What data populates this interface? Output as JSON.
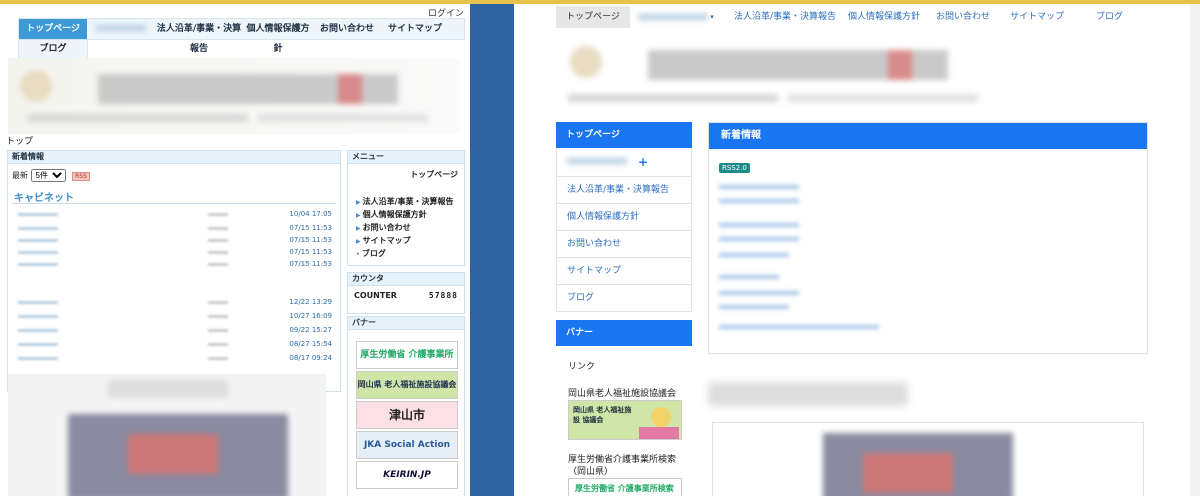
{
  "old_site": {
    "login": "ログイン",
    "nav_row1": [
      "トップページ",
      "",
      "法人沿革/事業・決算報告",
      "個人情報保護方針",
      "お問い合わせ",
      "サイトマップ"
    ],
    "nav_row2": "ブログ",
    "breadcrumb": "トップ",
    "news": {
      "title": "新着情報",
      "filter_label": "最新",
      "filter_value": "5件",
      "rss": "RSS",
      "cabinet": "キャビネット",
      "dates_group1": [
        "10/04 17:05",
        "07/15 11:53",
        "07/15 11:53",
        "07/15 11:53",
        "07/15 11:53"
      ],
      "dates_group2": [
        "12/22 13:29",
        "10/27 16:09",
        "09/22 15:27",
        "08/27 15:54",
        "08/17 09:24"
      ]
    },
    "menu": {
      "title": "メニュー",
      "top": "トップページ",
      "items": [
        "法人沿革/事業・決算報告",
        "個人情報保護方針",
        "お問い合わせ",
        "サイトマップ",
        "ブログ"
      ]
    },
    "counter": {
      "title": "カウンタ",
      "label": "COUNTER",
      "value": "57888"
    },
    "banner": {
      "title": "バナー",
      "items": [
        "厚生労働省 介護事業所検索",
        "岡山県 老人福祉施設協議会",
        "津山市",
        "JKA Social Action",
        "KEIRIN.JP"
      ]
    }
  },
  "new_site": {
    "nav": [
      "トップページ",
      "",
      "法人沿革/事業・決算報告",
      "個人情報保護方針",
      "お問い合わせ",
      "サイトマップ",
      "ブログ"
    ],
    "sidebar": {
      "top": "トップページ",
      "items": [
        "法人沿革/事業・決算報告",
        "個人情報保護方針",
        "お問い合わせ",
        "サイトマップ",
        "ブログ"
      ]
    },
    "banner_title": "バナー",
    "link_label": "リンク",
    "link_okayama": "岡山県老人福祉施設協議会",
    "link_kosei_1": "厚生労働省介護事業所検索",
    "link_kosei_2": "（岡山県）",
    "news_title": "新着情報",
    "rss": "RSS2.0",
    "banner_okayama": "岡山県 老人福祉施設 協議会",
    "banner_kosei": "厚生労働省 介護事業所検索"
  },
  "colors": {
    "primary": "#1976f0",
    "divider": "#2e63a4",
    "old_accent": "#3d9ad6"
  }
}
